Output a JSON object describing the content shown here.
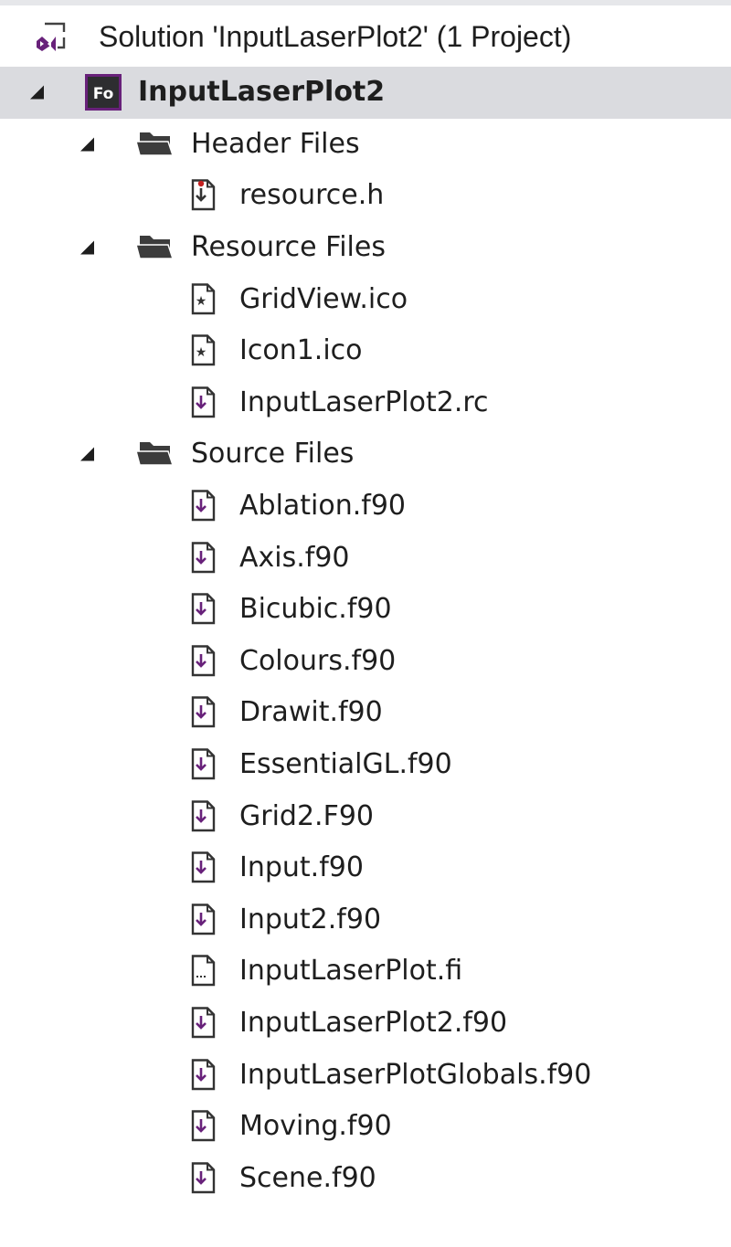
{
  "solution": {
    "label": "Solution 'InputLaserPlot2' (1 Project)",
    "icon": "visual-studio-solution-icon"
  },
  "project": {
    "label": "InputLaserPlot2",
    "icon": "fortran-project-icon",
    "icon_text": "Fo"
  },
  "folders": [
    {
      "label": "Header Files",
      "icon": "folder-icon",
      "files": [
        {
          "label": "resource.h",
          "icon": "header-file-icon"
        }
      ]
    },
    {
      "label": "Resource Files",
      "icon": "folder-icon",
      "files": [
        {
          "label": "GridView.ico",
          "icon": "icon-file-icon"
        },
        {
          "label": "Icon1.ico",
          "icon": "icon-file-icon"
        },
        {
          "label": "InputLaserPlot2.rc",
          "icon": "source-file-icon"
        }
      ]
    },
    {
      "label": "Source Files",
      "icon": "folder-icon",
      "files": [
        {
          "label": "Ablation.f90",
          "icon": "source-file-icon"
        },
        {
          "label": "Axis.f90",
          "icon": "source-file-icon"
        },
        {
          "label": "Bicubic.f90",
          "icon": "source-file-icon"
        },
        {
          "label": "Colours.f90",
          "icon": "source-file-icon"
        },
        {
          "label": "Drawit.f90",
          "icon": "source-file-icon"
        },
        {
          "label": "EssentialGL.f90",
          "icon": "source-file-icon"
        },
        {
          "label": "Grid2.F90",
          "icon": "source-file-icon"
        },
        {
          "label": "Input.f90",
          "icon": "source-file-icon"
        },
        {
          "label": "Input2.f90",
          "icon": "source-file-icon"
        },
        {
          "label": "InputLaserPlot.fi",
          "icon": "include-file-icon"
        },
        {
          "label": "InputLaserPlot2.f90",
          "icon": "source-file-icon"
        },
        {
          "label": "InputLaserPlotGlobals.f90",
          "icon": "source-file-icon"
        },
        {
          "label": "Moving.f90",
          "icon": "source-file-icon"
        },
        {
          "label": "Scene.f90",
          "icon": "source-file-icon"
        }
      ]
    }
  ],
  "colors": {
    "accent": "#68217a",
    "selection": "#dadbdf",
    "folder": "#3c3c3c",
    "text": "#1e1e1e"
  }
}
